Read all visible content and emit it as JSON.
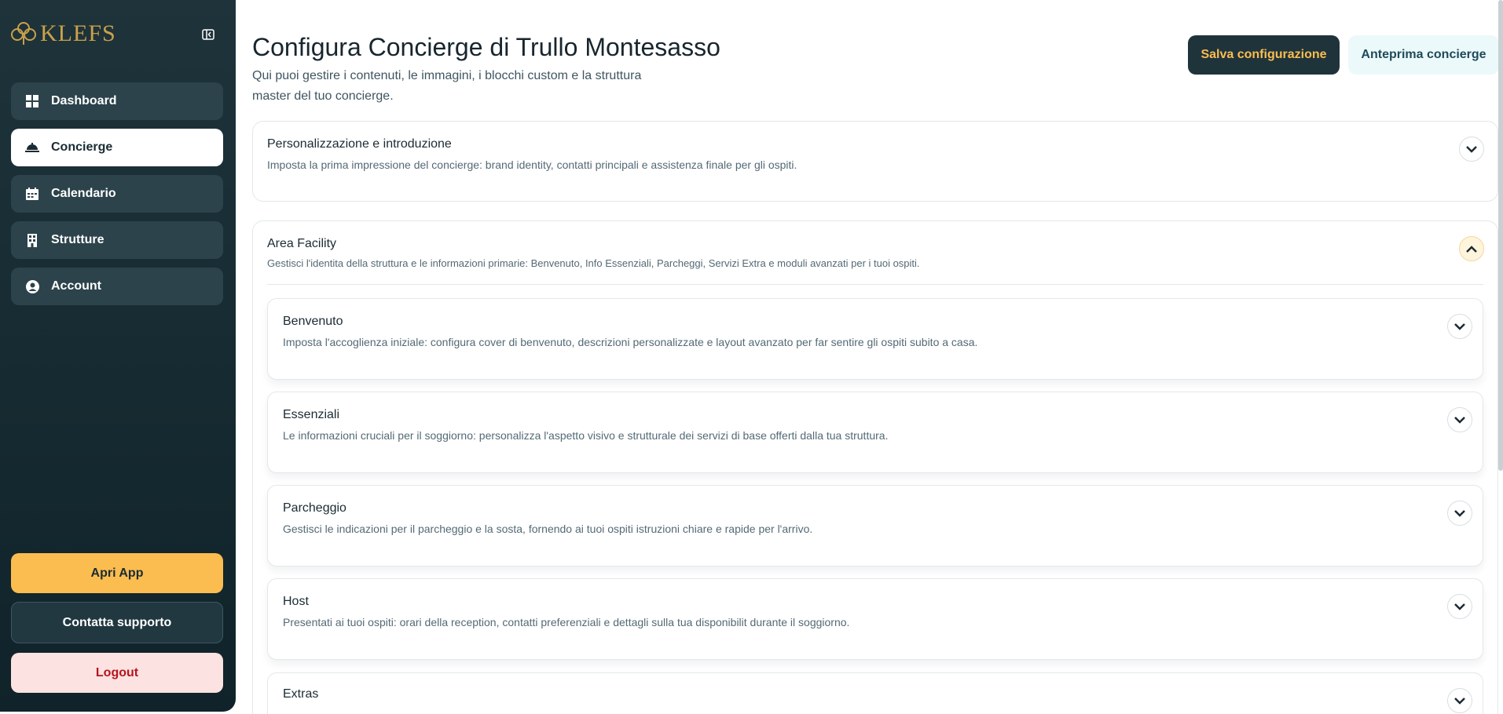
{
  "brand": {
    "name": "KLEFS",
    "color": "#c9a24a"
  },
  "sidebar": {
    "collapse_icon": "sidebar-collapse-icon",
    "items": [
      {
        "label": "Dashboard",
        "icon": "dashboard-grid-icon",
        "active": false
      },
      {
        "label": "Concierge",
        "icon": "concierge-bell-icon",
        "active": true
      },
      {
        "label": "Calendario",
        "icon": "calendar-icon",
        "active": false
      },
      {
        "label": "Strutture",
        "icon": "building-icon",
        "active": false
      },
      {
        "label": "Account",
        "icon": "user-circle-icon",
        "active": false
      }
    ],
    "open_app_label": "Apri App",
    "support_label": "Contatta supporto",
    "logout_label": "Logout"
  },
  "header": {
    "title": "Configura Concierge di Trullo Montesasso",
    "subtitle": "Qui puoi gestire i contenuti, le immagini, i blocchi custom e la struttura master del tuo concierge.",
    "save_label": "Salva configurazione",
    "preview_label": "Anteprima concierge"
  },
  "sections": [
    {
      "title": "Personalizzazione e introduzione",
      "description": "Imposta la prima impressione del concierge: brand identity, contatti principali e assistenza finale per gli ospiti.",
      "expanded": false
    },
    {
      "title": "Area Facility",
      "description": "Gestisci l'identita della struttura e le informazioni primarie: Benvenuto, Info Essenziali, Parcheggi, Servizi Extra e moduli avanzati per i tuoi ospiti.",
      "expanded": true,
      "children": [
        {
          "title": "Benvenuto",
          "description": "Imposta l'accoglienza iniziale: configura cover di benvenuto, descrizioni personalizzate e layout avanzato per far sentire gli ospiti subito a casa."
        },
        {
          "title": "Essenziali",
          "description": "Le informazioni cruciali per il soggiorno: personalizza l'aspetto visivo e strutturale dei servizi di base offerti dalla tua struttura."
        },
        {
          "title": "Parcheggio",
          "description": "Gestisci le indicazioni per il parcheggio e la sosta, fornendo ai tuoi ospiti istruzioni chiare e rapide per l'arrivo."
        },
        {
          "title": "Host",
          "description": "Presentati ai tuoi ospiti: orari della reception, contatti preferenziali e dettagli sulla tua disponibilit durante il soggiorno."
        },
        {
          "title": "Extras",
          "description": ""
        }
      ]
    }
  ],
  "colors": {
    "accent": "#fbbd4f",
    "sidebar": "#1f333b",
    "logout": "#b4161d"
  }
}
